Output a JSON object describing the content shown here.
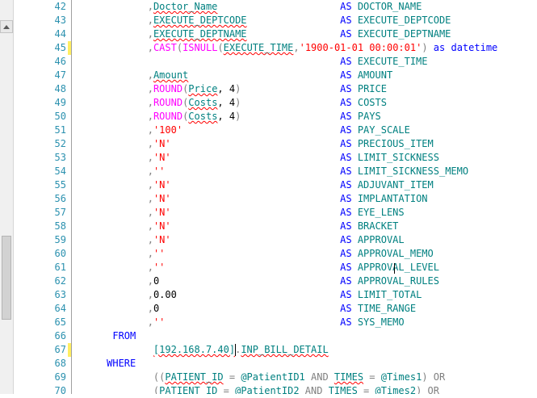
{
  "editor": {
    "lines": [
      {
        "n": "42",
        "marked": false,
        "indent": "            ",
        "prefix": ",",
        "expr": "Doctor_Name",
        "expr_kind": "id",
        "alias_kw": "AS",
        "alias": "DOCTOR_NAME"
      },
      {
        "n": "43",
        "marked": false,
        "indent": "            ",
        "prefix": ",",
        "expr": "EXECUTE_DEPTCODE",
        "expr_kind": "id",
        "alias_kw": "AS",
        "alias": "EXECUTE_DEPTCODE"
      },
      {
        "n": "44",
        "marked": false,
        "indent": "            ",
        "prefix": ",",
        "expr": "EXECUTE_DEPTNAME",
        "expr_kind": "id",
        "alias_kw": "AS",
        "alias": "EXECUTE_DEPTNAME"
      },
      {
        "n": "45",
        "marked": true,
        "raw": [
          {
            "t": "            ",
            "c": ""
          },
          {
            "t": ",",
            "c": "gray"
          },
          {
            "t": "CAST",
            "c": "fn"
          },
          {
            "t": "(",
            "c": "gray"
          },
          {
            "t": "ISNULL",
            "c": "fn"
          },
          {
            "t": "(",
            "c": "gray"
          },
          {
            "t": "EXECUTE_TIME",
            "c": "id"
          },
          {
            "t": ",",
            "c": "gray"
          },
          {
            "t": "'1900-01-01 00:00:01'",
            "c": "str"
          },
          {
            "t": ")",
            "c": "gray"
          },
          {
            "t": " as ",
            "c": "kw"
          },
          {
            "t": "datetime",
            "c": "kw"
          }
        ]
      },
      {
        "n": "46",
        "marked": false,
        "indent": "",
        "prefix": "",
        "expr": "",
        "expr_kind": "",
        "alias_kw": "AS",
        "alias": "EXECUTE_TIME"
      },
      {
        "n": "47",
        "marked": false,
        "indent": "            ",
        "prefix": ",",
        "expr": "Amount",
        "expr_kind": "id",
        "alias_kw": "AS",
        "alias": "AMOUNT"
      },
      {
        "n": "48",
        "marked": false,
        "raw": [
          {
            "t": "            ",
            "c": ""
          },
          {
            "t": ",",
            "c": "gray"
          },
          {
            "t": "ROUND",
            "c": "fn"
          },
          {
            "t": "(",
            "c": "gray"
          },
          {
            "t": "Price",
            "c": "id"
          },
          {
            "t": ", 4",
            "c": ""
          },
          {
            "t": ")",
            "c": "gray"
          }
        ],
        "alias_kw": "AS",
        "alias": "PRICE"
      },
      {
        "n": "49",
        "marked": false,
        "raw": [
          {
            "t": "            ",
            "c": ""
          },
          {
            "t": ",",
            "c": "gray"
          },
          {
            "t": "ROUND",
            "c": "fn"
          },
          {
            "t": "(",
            "c": "gray"
          },
          {
            "t": "Costs",
            "c": "id"
          },
          {
            "t": ", 4",
            "c": ""
          },
          {
            "t": ")",
            "c": "gray"
          }
        ],
        "alias_kw": "AS",
        "alias": "COSTS"
      },
      {
        "n": "50",
        "marked": false,
        "raw": [
          {
            "t": "            ",
            "c": ""
          },
          {
            "t": ",",
            "c": "gray"
          },
          {
            "t": "ROUND",
            "c": "fn"
          },
          {
            "t": "(",
            "c": "gray"
          },
          {
            "t": "Costs",
            "c": "id"
          },
          {
            "t": ", 4",
            "c": ""
          },
          {
            "t": ")",
            "c": "gray"
          }
        ],
        "alias_kw": "AS",
        "alias": "PAYS"
      },
      {
        "n": "51",
        "marked": false,
        "indent": "            ",
        "prefix": ",",
        "expr": "'100'",
        "expr_kind": "str",
        "alias_kw": "AS",
        "alias": "PAY_SCALE"
      },
      {
        "n": "52",
        "marked": false,
        "indent": "            ",
        "prefix": ",",
        "expr": "'N'",
        "expr_kind": "str",
        "alias_kw": "AS",
        "alias": "PRECIOUS_ITEM"
      },
      {
        "n": "53",
        "marked": false,
        "indent": "            ",
        "prefix": ",",
        "expr": "'N'",
        "expr_kind": "str",
        "alias_kw": "AS",
        "alias": "LIMIT_SICKNESS"
      },
      {
        "n": "54",
        "marked": false,
        "indent": "            ",
        "prefix": ",",
        "expr": "''",
        "expr_kind": "str",
        "alias_kw": "AS",
        "alias": "LIMIT_SICKNESS_MEMO"
      },
      {
        "n": "55",
        "marked": false,
        "indent": "            ",
        "prefix": ",",
        "expr": "'N'",
        "expr_kind": "str",
        "alias_kw": "AS",
        "alias": "ADJUVANT_ITEM"
      },
      {
        "n": "56",
        "marked": false,
        "indent": "            ",
        "prefix": ",",
        "expr": "'N'",
        "expr_kind": "str",
        "alias_kw": "AS",
        "alias": "IMPLANTATION"
      },
      {
        "n": "57",
        "marked": false,
        "indent": "            ",
        "prefix": ",",
        "expr": "'N'",
        "expr_kind": "str",
        "alias_kw": "AS",
        "alias": "EYE_LENS"
      },
      {
        "n": "58",
        "marked": false,
        "indent": "            ",
        "prefix": ",",
        "expr": "'N'",
        "expr_kind": "str",
        "alias_kw": "AS",
        "alias": "BRACKET"
      },
      {
        "n": "59",
        "marked": false,
        "indent": "            ",
        "prefix": ",",
        "expr": "'N'",
        "expr_kind": "str",
        "alias_kw": "AS",
        "alias": "APPROVAL"
      },
      {
        "n": "60",
        "marked": false,
        "indent": "            ",
        "prefix": ",",
        "expr": "''",
        "expr_kind": "str",
        "alias_kw": "AS",
        "alias": "APPROVAL_MEMO"
      },
      {
        "n": "61",
        "marked": false,
        "indent": "            ",
        "prefix": ",",
        "expr": "''",
        "expr_kind": "str",
        "alias_kw": "AS",
        "alias": "APPROVAL_LEVEL"
      },
      {
        "n": "62",
        "marked": false,
        "indent": "            ",
        "prefix": ",",
        "expr": "0",
        "expr_kind": "plain",
        "alias_kw": "AS",
        "alias": "APPROVAL_RULES"
      },
      {
        "n": "63",
        "marked": false,
        "indent": "            ",
        "prefix": ",",
        "expr": "0.00",
        "expr_kind": "plain",
        "alias_kw": "AS",
        "alias": "LIMIT_TOTAL"
      },
      {
        "n": "64",
        "marked": false,
        "indent": "            ",
        "prefix": ",",
        "expr": "0",
        "expr_kind": "plain",
        "alias_kw": "AS",
        "alias": "TIME_RANGE"
      },
      {
        "n": "65",
        "marked": false,
        "indent": "            ",
        "prefix": ",",
        "expr": "''",
        "expr_kind": "str",
        "alias_kw": "AS",
        "alias": "SYS_MEMO"
      },
      {
        "n": "66",
        "marked": false,
        "raw": [
          {
            "t": "      ",
            "c": ""
          },
          {
            "t": "FROM",
            "c": "kw"
          }
        ]
      },
      {
        "n": "67",
        "marked": true,
        "raw": [
          {
            "t": "             ",
            "c": ""
          },
          {
            "t": "[192.168.7.40]",
            "c": "id"
          },
          {
            "t": ".",
            "c": "gray"
          },
          {
            "t": "INP_BILL_DETAIL",
            "c": "id"
          }
        ]
      },
      {
        "n": "68",
        "marked": false,
        "raw": [
          {
            "t": "     ",
            "c": ""
          },
          {
            "t": "WHERE",
            "c": "kw"
          }
        ]
      },
      {
        "n": "69",
        "marked": false,
        "raw": [
          {
            "t": "             ",
            "c": ""
          },
          {
            "t": "((",
            "c": "gray"
          },
          {
            "t": "PATIENT_ID",
            "c": "id"
          },
          {
            "t": " = ",
            "c": "gray"
          },
          {
            "t": "@PatientID1",
            "c": "plain-id"
          },
          {
            "t": " AND ",
            "c": "gray"
          },
          {
            "t": "TIMES",
            "c": "id"
          },
          {
            "t": " = ",
            "c": "gray"
          },
          {
            "t": "@Times1",
            "c": "plain-id"
          },
          {
            "t": ")",
            "c": "gray"
          },
          {
            "t": " OR",
            "c": "gray"
          }
        ]
      },
      {
        "n": "70",
        "marked": false,
        "raw": [
          {
            "t": "             ",
            "c": ""
          },
          {
            "t": "(",
            "c": "gray"
          },
          {
            "t": "PATIENT_ID",
            "c": "id"
          },
          {
            "t": " = ",
            "c": "gray"
          },
          {
            "t": "@PatientID2",
            "c": "plain-id"
          },
          {
            "t": " AND ",
            "c": "gray"
          },
          {
            "t": "TIMES",
            "c": "id"
          },
          {
            "t": " = ",
            "c": "gray"
          },
          {
            "t": "@Times2",
            "c": "plain-id"
          },
          {
            "t": ")",
            "c": "gray"
          },
          {
            "t": " OR",
            "c": "gray"
          }
        ]
      }
    ]
  }
}
